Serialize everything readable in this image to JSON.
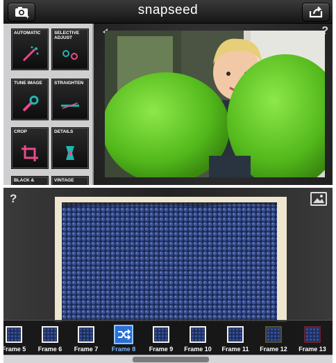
{
  "top_screen": {
    "app_title": "snapseed",
    "camera_icon": "camera-icon",
    "share_icon": "share-icon",
    "undo_icon": "undo-icon",
    "help_label": "?",
    "tools": [
      {
        "label": "AUTOMATIC",
        "icon": "wand-icon"
      },
      {
        "label": "SELECTIVE ADJUST",
        "icon": "points-icon"
      },
      {
        "label": "TUNE IMAGE",
        "icon": "wrench-icon"
      },
      {
        "label": "STRAIGHTEN",
        "icon": "straighten-icon"
      },
      {
        "label": "CROP",
        "icon": "crop-icon"
      },
      {
        "label": "DETAILS",
        "icon": "details-icon"
      },
      {
        "label": "BLACK &",
        "icon": "bw-icon"
      },
      {
        "label": "VINTAGE",
        "icon": "vintage-icon"
      }
    ],
    "colors": {
      "accent_pink": "#e84a8a",
      "accent_teal": "#1fb6b0",
      "balloon_green": "#6fd12a"
    }
  },
  "bottom_screen": {
    "help_label": "?",
    "image_icon": "image-icon",
    "frames": [
      {
        "label": "Frame 5"
      },
      {
        "label": "Frame 6"
      },
      {
        "label": "Frame 7"
      },
      {
        "label": "Frame 8",
        "selected": true
      },
      {
        "label": "Frame 9"
      },
      {
        "label": "Frame 10"
      },
      {
        "label": "Frame 11"
      },
      {
        "label": "Frame 12"
      },
      {
        "label": "Frame 13"
      }
    ],
    "colors": {
      "selected_frame": "#2b6fd6",
      "blueberry": "#2f4a8f"
    }
  }
}
